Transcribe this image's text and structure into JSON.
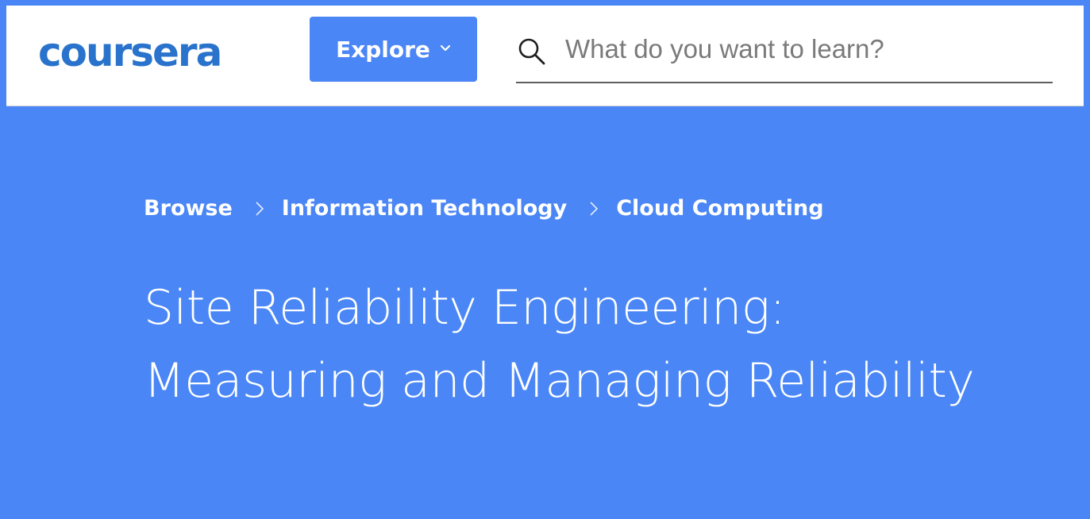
{
  "header": {
    "logo_text": "coursera",
    "explore_label": "Explore",
    "search": {
      "placeholder": "What do you want to learn?",
      "value": ""
    }
  },
  "breadcrumb": {
    "items": [
      {
        "label": "Browse"
      },
      {
        "label": "Information Technology"
      },
      {
        "label": "Cloud Computing"
      }
    ]
  },
  "course": {
    "title": "Site Reliability Engineering: Measuring and Managing Reliability"
  },
  "colors": {
    "brand_blue": "#4a86f5",
    "header_bg": "#ffffff",
    "text_on_blue": "#ffffff"
  }
}
